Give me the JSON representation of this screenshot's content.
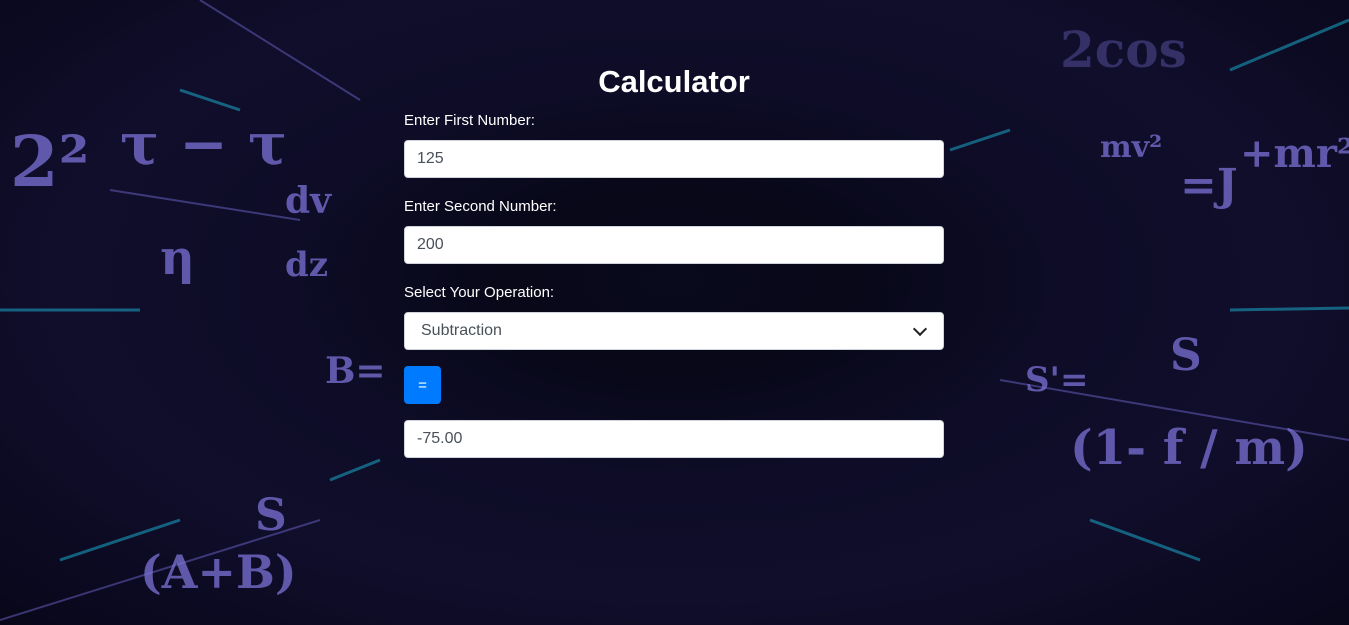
{
  "page": {
    "title": "Calculator"
  },
  "form": {
    "first_label": "Enter First Number:",
    "first_value": "125",
    "second_label": "Enter Second Number:",
    "second_value": "200",
    "operation_label": "Select Your Operation:",
    "operation_selected": "Subtraction",
    "equals_label": "=",
    "result_value": "-75.00"
  },
  "colors": {
    "accent": "#007bff",
    "formula": "#7c72d6",
    "background": "#05040c"
  },
  "background_formulas": [
    "2cos",
    "τ − τ",
    "dv",
    "dz",
    "η",
    "B=",
    "S",
    "S'=",
    "(1- f / m)",
    "(A+B)",
    "mv²",
    "=J",
    "+mr²",
    "2²"
  ]
}
